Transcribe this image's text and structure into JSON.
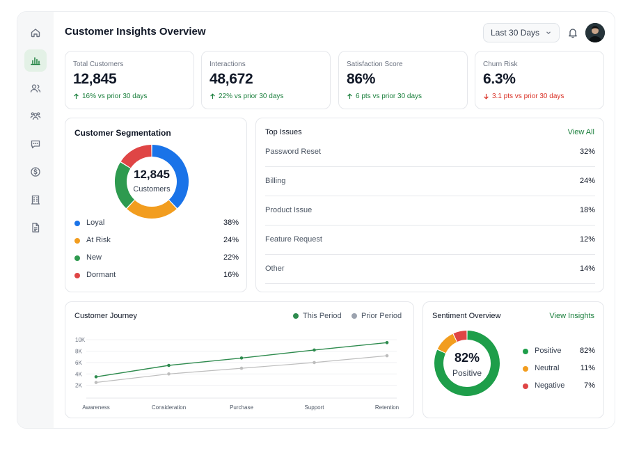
{
  "header": {
    "title": "Customer Insights Overview",
    "date_range": "Last 30 Days"
  },
  "sidebar": {
    "items": [
      {
        "icon": "home-icon",
        "active": false
      },
      {
        "icon": "bar-chart-icon",
        "active": true
      },
      {
        "icon": "users-icon",
        "active": false
      },
      {
        "icon": "team-icon",
        "active": false
      },
      {
        "icon": "chat-icon",
        "active": false
      },
      {
        "icon": "dollar-icon",
        "active": false
      },
      {
        "icon": "building-icon",
        "active": false
      },
      {
        "icon": "document-icon",
        "active": false
      }
    ]
  },
  "kpis": [
    {
      "label": "Total Customers",
      "value": "12,845",
      "delta": "16% vs prior 30 days",
      "trend": "up"
    },
    {
      "label": "Interactions",
      "value": "48,672",
      "delta": "22% vs prior 30 days",
      "trend": "up"
    },
    {
      "label": "Satisfaction Score",
      "value": "86%",
      "delta": "6 pts vs prior 30 days",
      "trend": "up"
    },
    {
      "label": "Churn Risk",
      "value": "6.3%",
      "delta": "3.1 pts vs prior 30 days",
      "trend": "down"
    }
  ],
  "segmentation": {
    "title": "Customer Segmentation",
    "center_value": "12,845",
    "center_label": "Customers",
    "segments": [
      {
        "name": "Loyal",
        "value": "38%",
        "pct": 38,
        "color": "#1a73e8"
      },
      {
        "name": "At Risk",
        "value": "24%",
        "pct": 24,
        "color": "#f29d1f"
      },
      {
        "name": "New",
        "value": "22%",
        "pct": 22,
        "color": "#2e9a4f"
      },
      {
        "name": "Dormant",
        "value": "16%",
        "pct": 16,
        "color": "#df4545"
      }
    ]
  },
  "top_issues": {
    "title": "Top Issues",
    "link": "View All",
    "items": [
      {
        "name": "Password Reset",
        "value": "32%"
      },
      {
        "name": "Billing",
        "value": "24%"
      },
      {
        "name": "Product Issue",
        "value": "18%"
      },
      {
        "name": "Feature Request",
        "value": "12%"
      },
      {
        "name": "Other",
        "value": "14%"
      }
    ]
  },
  "journey": {
    "title": "Customer Journey"
  },
  "chart_data": {
    "type": "line",
    "categories": [
      "Awareness",
      "Consideration",
      "Purchase",
      "Support",
      "Retention"
    ],
    "series": [
      {
        "name": "This Period",
        "color": "#2e8b4e",
        "values": [
          3.5,
          5.5,
          6.8,
          8.2,
          9.5
        ]
      },
      {
        "name": "Prior Period",
        "color": "#bdbdbd",
        "values": [
          2.5,
          4.0,
          5.0,
          6.0,
          7.2
        ]
      }
    ],
    "yticks": [
      "10K",
      "8K",
      "6K",
      "4K",
      "2K"
    ],
    "ylim": [
      0,
      11
    ]
  },
  "sentiment": {
    "title": "Sentiment Overview",
    "link": "View Insights",
    "center_value": "82%",
    "center_label": "Positive",
    "segments": [
      {
        "name": "Positive",
        "value": "82%",
        "pct": 82,
        "color": "#1e9e4a"
      },
      {
        "name": "Neutral",
        "value": "11%",
        "pct": 11,
        "color": "#f29d1f"
      },
      {
        "name": "Negative",
        "value": "7%",
        "pct": 7,
        "color": "#df4545"
      }
    ]
  }
}
